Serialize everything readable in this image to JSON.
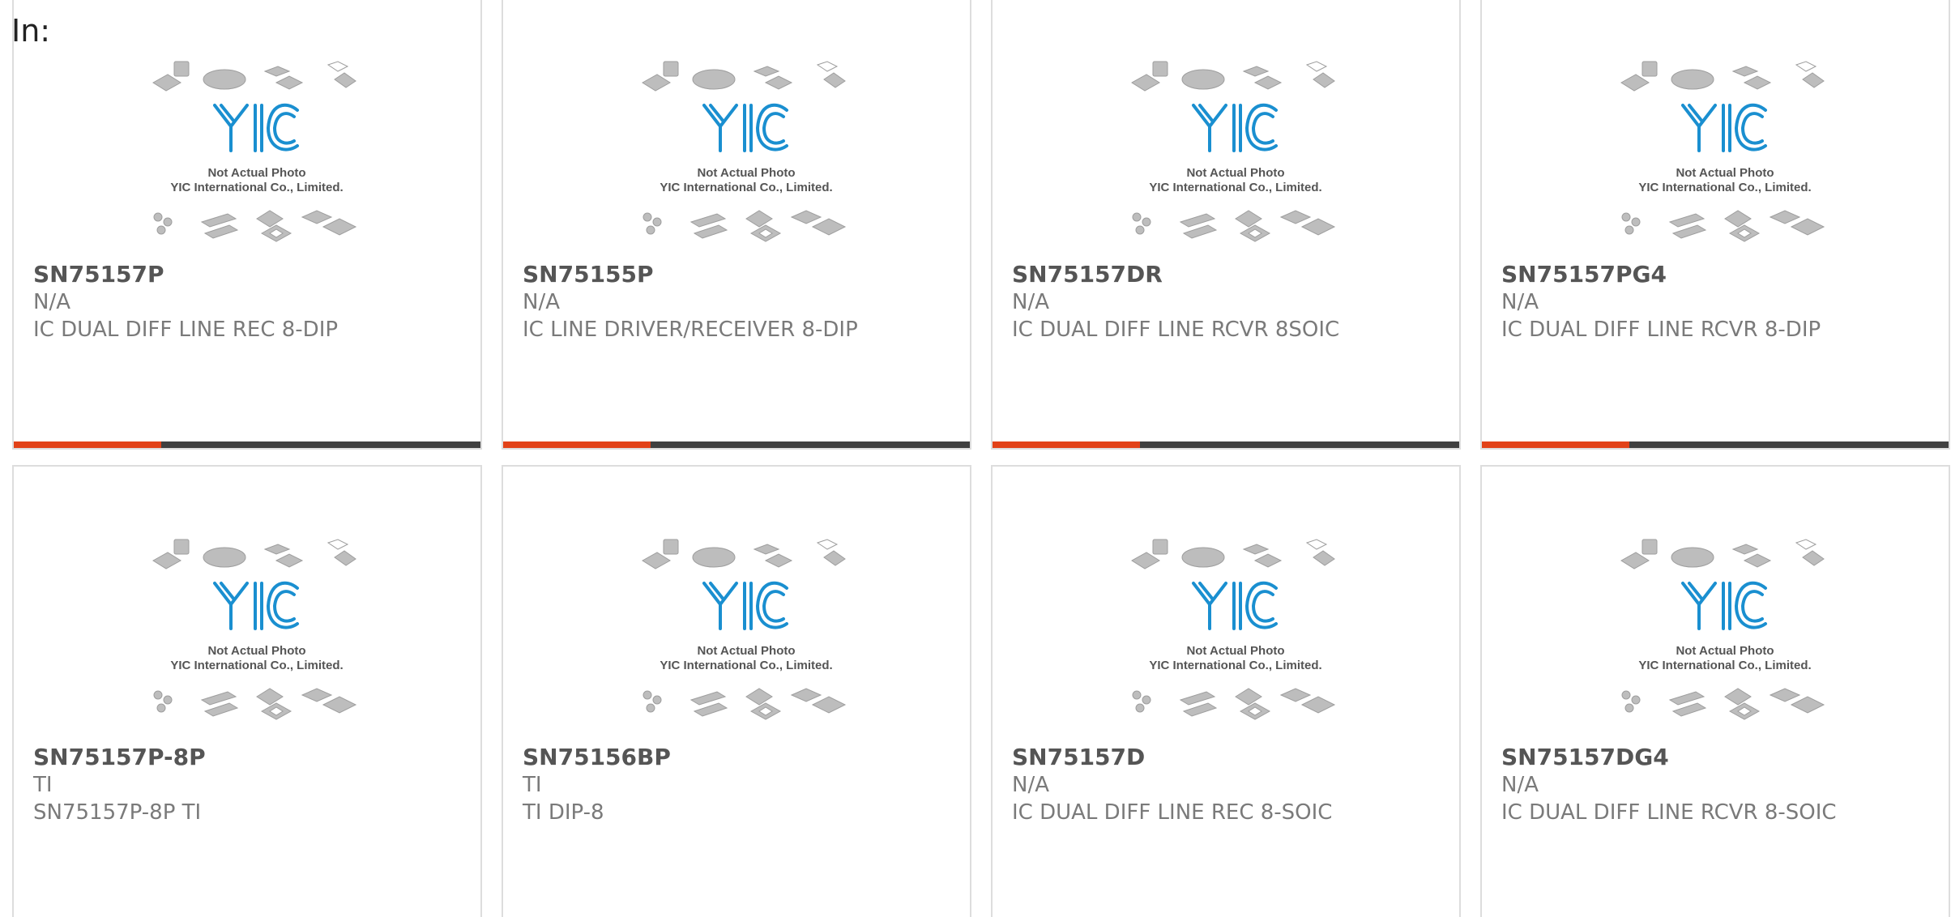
{
  "page": {
    "in_label": "In:"
  },
  "placeholder": {
    "line1": "Not Actual Photo",
    "line2": "YIC International Co., Limited."
  },
  "colors": {
    "accent": "#e24218",
    "bar_dark": "#404040",
    "logo_blue": "#1a8fd0"
  },
  "products": [
    {
      "part": "SN75157P",
      "manufacturer": "N/A",
      "description": "IC DUAL DIFF LINE REC 8-DIP"
    },
    {
      "part": "SN75155P",
      "manufacturer": "N/A",
      "description": "IC LINE DRIVER/RECEIVER 8-DIP"
    },
    {
      "part": "SN75157DR",
      "manufacturer": "N/A",
      "description": "IC DUAL DIFF LINE RCVR 8SOIC"
    },
    {
      "part": "SN75157PG4",
      "manufacturer": "N/A",
      "description": "IC DUAL DIFF LINE RCVR 8-DIP"
    },
    {
      "part": "SN75157P-8P",
      "manufacturer": "TI",
      "description": "SN75157P-8P TI"
    },
    {
      "part": "SN75156BP",
      "manufacturer": "TI",
      "description": "TI DIP-8"
    },
    {
      "part": "SN75157D",
      "manufacturer": "N/A",
      "description": "IC DUAL DIFF LINE REC 8-SOIC"
    },
    {
      "part": "SN75157DG4",
      "manufacturer": "N/A",
      "description": "IC DUAL DIFF LINE RCVR 8-SOIC"
    }
  ]
}
